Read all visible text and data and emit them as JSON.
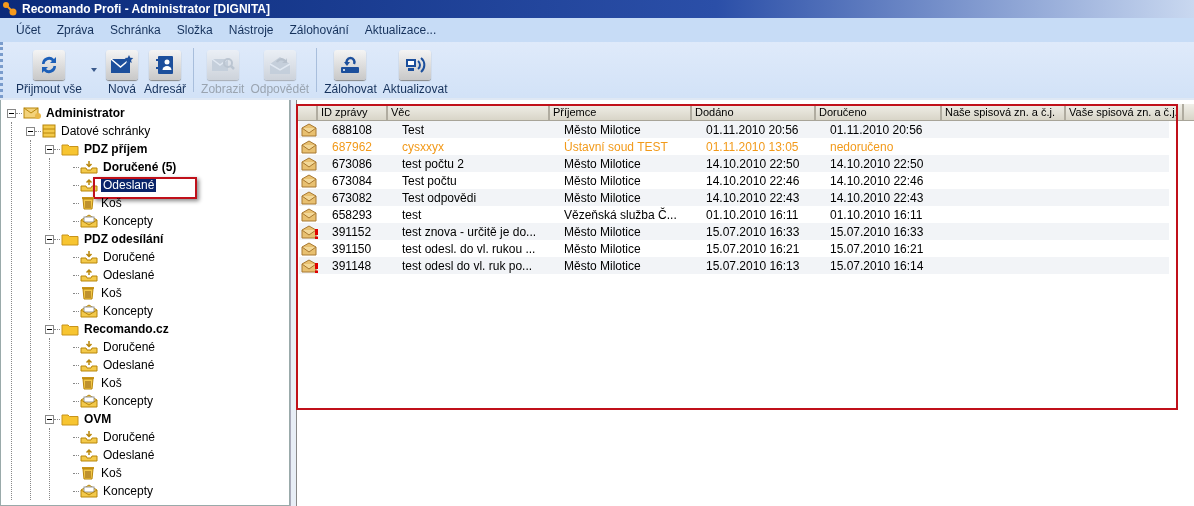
{
  "window": {
    "title": "Recomando Profi - Administrator [DIGNITA]"
  },
  "menu": [
    "Účet",
    "Zpráva",
    "Schránka",
    "Složka",
    "Nástroje",
    "Zálohování",
    "Aktualizace..."
  ],
  "toolbar": [
    {
      "label": "Přijmout vše",
      "kind": "sync",
      "disabled": false,
      "dropdown": true
    },
    {
      "label": "Nová",
      "kind": "new",
      "disabled": false,
      "dropdown": false
    },
    {
      "label": "Adresář",
      "kind": "contacts",
      "disabled": false,
      "dropdown": false
    },
    {
      "label": "Zobrazit",
      "kind": "view",
      "disabled": true,
      "dropdown": false
    },
    {
      "label": "Odpovědět",
      "kind": "reply",
      "disabled": true,
      "dropdown": false
    },
    {
      "label": "Zálohovat",
      "kind": "backup",
      "disabled": false,
      "dropdown": false
    },
    {
      "label": "Aktualizovat",
      "kind": "update",
      "disabled": false,
      "dropdown": false
    }
  ],
  "tree": [
    {
      "label": "Administrator",
      "kind": "root",
      "expanded": true,
      "children": [
        {
          "label": "Datové schránky",
          "kind": "boxes",
          "expanded": true,
          "children": [
            {
              "label": "PDZ příjem",
              "kind": "folder",
              "expanded": true,
              "children": [
                {
                  "label": "Doručené (5)",
                  "kind": "inbox",
                  "unread": true,
                  "selected": false
                },
                {
                  "label": "Odeslané",
                  "kind": "outbox",
                  "unread": false,
                  "selected": true
                },
                {
                  "label": "Koš",
                  "kind": "trash",
                  "unread": false,
                  "selected": false
                },
                {
                  "label": "Koncepty",
                  "kind": "drafts",
                  "unread": false,
                  "selected": false
                }
              ]
            },
            {
              "label": "PDZ odesílání",
              "kind": "folder",
              "expanded": true,
              "children": [
                {
                  "label": "Doručené",
                  "kind": "inbox",
                  "unread": false,
                  "selected": false
                },
                {
                  "label": "Odeslané",
                  "kind": "outbox",
                  "unread": false,
                  "selected": false
                },
                {
                  "label": "Koš",
                  "kind": "trash",
                  "unread": false,
                  "selected": false
                },
                {
                  "label": "Koncepty",
                  "kind": "drafts",
                  "unread": false,
                  "selected": false
                }
              ]
            },
            {
              "label": "Recomando.cz",
              "kind": "folder",
              "expanded": true,
              "children": [
                {
                  "label": "Doručené",
                  "kind": "inbox",
                  "unread": false,
                  "selected": false
                },
                {
                  "label": "Odeslané",
                  "kind": "outbox",
                  "unread": false,
                  "selected": false
                },
                {
                  "label": "Koš",
                  "kind": "trash",
                  "unread": false,
                  "selected": false
                },
                {
                  "label": "Koncepty",
                  "kind": "drafts",
                  "unread": false,
                  "selected": false
                }
              ]
            },
            {
              "label": "OVM",
              "kind": "folder",
              "expanded": true,
              "children": [
                {
                  "label": "Doručené",
                  "kind": "inbox",
                  "unread": false,
                  "selected": false
                },
                {
                  "label": "Odeslané",
                  "kind": "outbox",
                  "unread": false,
                  "selected": false
                },
                {
                  "label": "Koš",
                  "kind": "trash",
                  "unread": false,
                  "selected": false
                },
                {
                  "label": "Koncepty",
                  "kind": "drafts",
                  "unread": false,
                  "selected": false
                }
              ]
            }
          ]
        }
      ]
    }
  ],
  "table": {
    "highlighted": true,
    "columns": [
      "ID zprávy",
      "Věc",
      "Příjemce",
      "Dodáno",
      "Doručeno",
      "Naše spisová zn. a č.j.",
      "Vaše spisová zn. a č.j."
    ],
    "rows": [
      {
        "cells": [
          "688108",
          "Test",
          "Město Milotice",
          "01.11.2010 20:56",
          "01.11.2010 20:56"
        ],
        "undelivered": false,
        "urgent": false
      },
      {
        "cells": [
          "687962",
          "cysxxyx",
          "Ústavní soud TEST",
          "01.11.2010 13:05",
          "nedoručeno"
        ],
        "undelivered": true,
        "urgent": false
      },
      {
        "cells": [
          "673086",
          "test počtu 2",
          "Město Milotice",
          "14.10.2010 22:50",
          "14.10.2010 22:50"
        ],
        "undelivered": false,
        "urgent": false
      },
      {
        "cells": [
          "673084",
          "Test počtu",
          "Město Milotice",
          "14.10.2010 22:46",
          "14.10.2010 22:46"
        ],
        "undelivered": false,
        "urgent": false
      },
      {
        "cells": [
          "673082",
          "Test odpovědi",
          "Město Milotice",
          "14.10.2010 22:43",
          "14.10.2010 22:43"
        ],
        "undelivered": false,
        "urgent": false
      },
      {
        "cells": [
          "658293",
          "test",
          "Vězeňská služba Č...",
          "01.10.2010 16:11",
          "01.10.2010 16:11"
        ],
        "undelivered": false,
        "urgent": false
      },
      {
        "cells": [
          "391152",
          "test znova - určitě je do...",
          "Město Milotice",
          "15.07.2010 16:33",
          "15.07.2010 16:33"
        ],
        "undelivered": false,
        "urgent": true
      },
      {
        "cells": [
          "391150",
          "test odesl. do vl. rukou ...",
          "Město Milotice",
          "15.07.2010 16:21",
          "15.07.2010 16:21"
        ],
        "undelivered": false,
        "urgent": false
      },
      {
        "cells": [
          "391148",
          "test odesl do vl. ruk po...",
          "Město Milotice",
          "15.07.2010 16:13",
          "15.07.2010 16:14"
        ],
        "undelivered": false,
        "urgent": true
      }
    ]
  }
}
